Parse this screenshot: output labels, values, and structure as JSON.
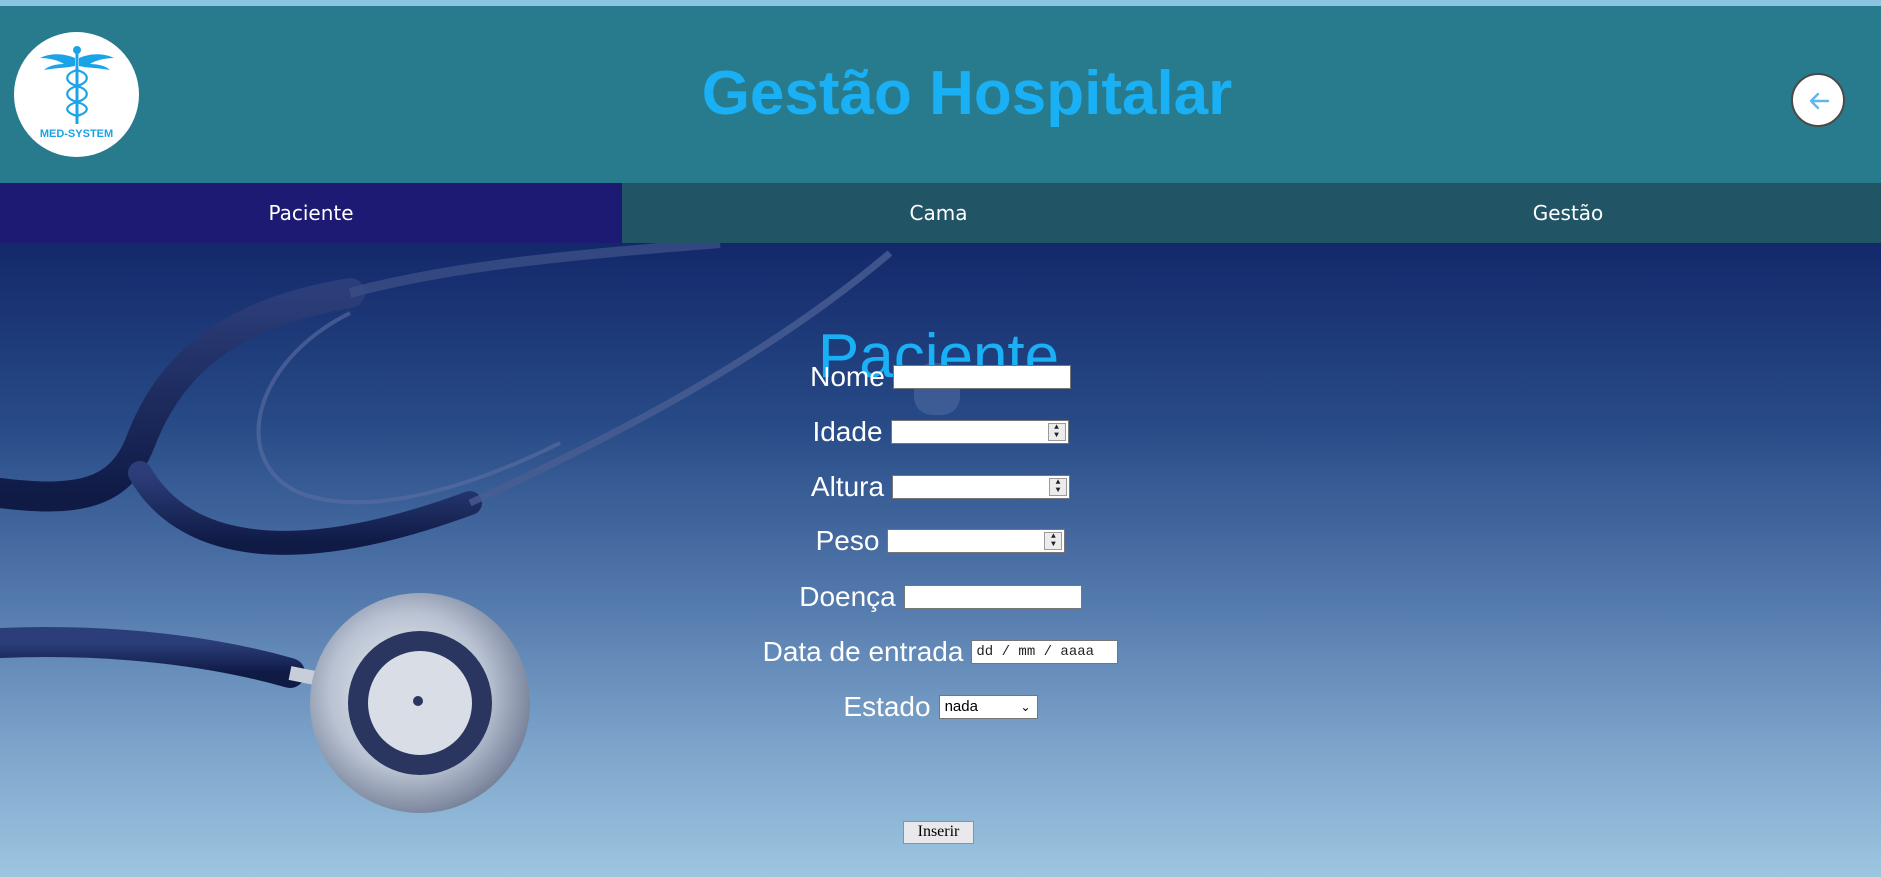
{
  "header": {
    "logo_text": "MED-SYSTEM",
    "title": "Gestão Hospitalar",
    "back_icon": "arrow-left-icon"
  },
  "nav": {
    "items": [
      {
        "label": "Paciente",
        "active": true
      },
      {
        "label": "Cama",
        "active": false
      },
      {
        "label": "Gestão",
        "active": false
      }
    ]
  },
  "form": {
    "title": "Paciente",
    "fields": {
      "nome": {
        "label": "Nome",
        "value": ""
      },
      "idade": {
        "label": "Idade",
        "value": ""
      },
      "altura": {
        "label": "Altura",
        "value": ""
      },
      "peso": {
        "label": "Peso",
        "value": ""
      },
      "doenca": {
        "label": "Doença",
        "value": ""
      },
      "data_entrada": {
        "label": "Data de entrada",
        "placeholder": "dd / mm / aaaa"
      },
      "estado": {
        "label": "Estado",
        "selected": "nada"
      }
    },
    "submit_label": "Inserir"
  },
  "colors": {
    "header_bg": "#277b8c",
    "title_blue": "#1ab0f5",
    "nav_active": "#1d1a73",
    "nav_inactive": "#215566"
  }
}
